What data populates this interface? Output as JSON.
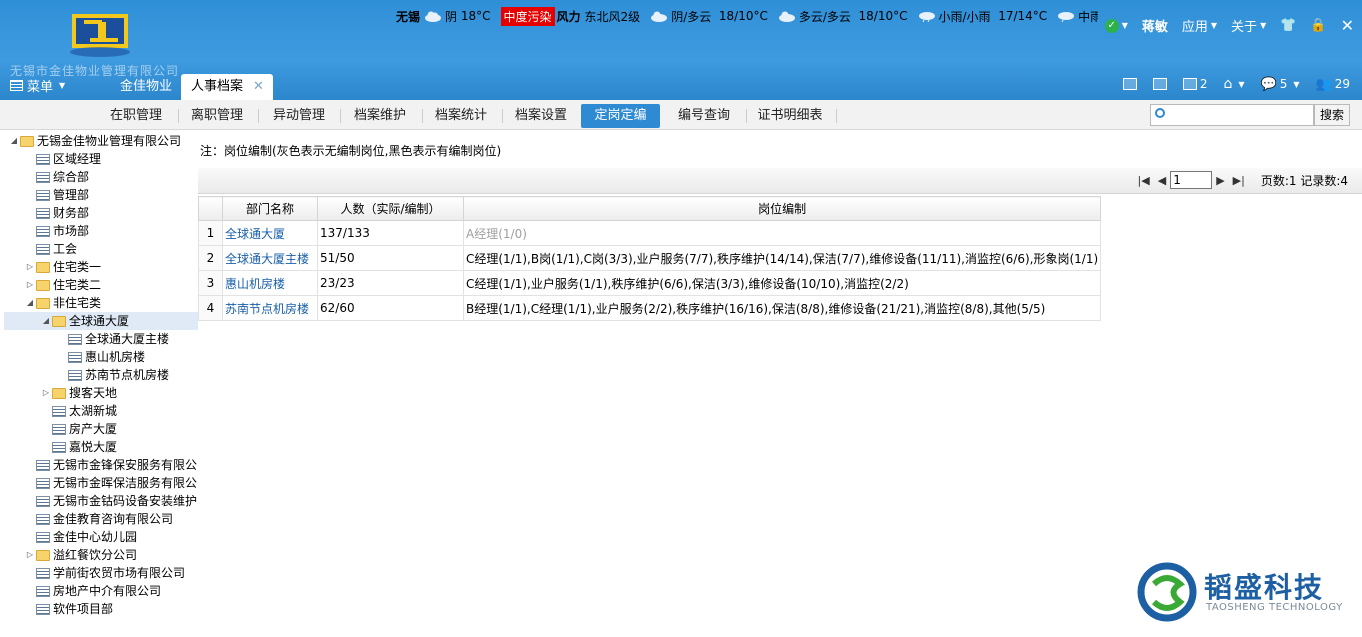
{
  "header": {
    "company_name": "无锡市金佳物业管理有限公司",
    "weather": {
      "city": "无锡",
      "today": {
        "condition": "阴",
        "temp": "18°C"
      },
      "pollution": "中度污染",
      "wind_label": "风力",
      "wind": "东北风2级",
      "forecast": [
        {
          "condition": "阴/多云",
          "temp": "18/10°C"
        },
        {
          "condition": "多云/多云",
          "temp": "18/10°C"
        },
        {
          "condition": "小雨/小雨",
          "temp": "17/14°C"
        },
        {
          "condition": "中雨/阴",
          "temp": ""
        }
      ]
    },
    "user": {
      "name": "蒋敏",
      "status_icon": "check-circle-icon"
    },
    "menus": {
      "apps": "应用",
      "about": "关于"
    },
    "icons": [
      "shirt-icon",
      "lock-icon",
      "close-icon"
    ]
  },
  "tabbar": {
    "menu_label": "菜单",
    "tabs": [
      {
        "label": "金佳物业",
        "active": false
      },
      {
        "label": "人事档案",
        "active": true
      }
    ],
    "toolbar_counts": {
      "docs": "2",
      "messages": "5",
      "users": "29"
    }
  },
  "subnav": {
    "tabs": [
      "在职管理",
      "离职管理",
      "异动管理",
      "档案维护",
      "档案统计",
      "档案设置",
      "定岗定编",
      "编号查询",
      "证书明细表"
    ],
    "active_index": 6,
    "search": {
      "placeholder": "",
      "button": "搜索"
    }
  },
  "tree": {
    "nodes": [
      {
        "label": "无锡金佳物业管理有限公司",
        "level": 0,
        "type": "folder",
        "expanded": true
      },
      {
        "label": "区域经理",
        "level": 1,
        "type": "leaf"
      },
      {
        "label": "综合部",
        "level": 1,
        "type": "leaf"
      },
      {
        "label": "管理部",
        "level": 1,
        "type": "leaf"
      },
      {
        "label": "财务部",
        "level": 1,
        "type": "leaf"
      },
      {
        "label": "市场部",
        "level": 1,
        "type": "leaf"
      },
      {
        "label": "工会",
        "level": 1,
        "type": "leaf"
      },
      {
        "label": "住宅类一",
        "level": 1,
        "type": "folder",
        "expanded": false
      },
      {
        "label": "住宅类二",
        "level": 1,
        "type": "folder",
        "expanded": false
      },
      {
        "label": "非住宅类",
        "level": 1,
        "type": "folder",
        "expanded": true
      },
      {
        "label": "全球通大厦",
        "level": 2,
        "type": "folder",
        "expanded": true,
        "selected": true
      },
      {
        "label": "全球通大厦主楼",
        "level": 3,
        "type": "leaf"
      },
      {
        "label": "惠山机房楼",
        "level": 3,
        "type": "leaf"
      },
      {
        "label": "苏南节点机房楼",
        "level": 3,
        "type": "leaf"
      },
      {
        "label": "搜客天地",
        "level": 2,
        "type": "folder",
        "expanded": false
      },
      {
        "label": "太湖新城",
        "level": 2,
        "type": "leaf"
      },
      {
        "label": "房产大厦",
        "level": 2,
        "type": "leaf"
      },
      {
        "label": "嘉悦大厦",
        "level": 2,
        "type": "leaf"
      },
      {
        "label": "无锡市金锋保安服务有限公司",
        "level": 1,
        "type": "leaf"
      },
      {
        "label": "无锡市金晖保洁服务有限公司",
        "level": 1,
        "type": "leaf"
      },
      {
        "label": "无锡市金钴码设备安装维护",
        "level": 1,
        "type": "leaf"
      },
      {
        "label": "金佳教育咨询有限公司",
        "level": 1,
        "type": "leaf"
      },
      {
        "label": "金佳中心幼儿园",
        "level": 1,
        "type": "leaf"
      },
      {
        "label": "溢红餐饮分公司",
        "level": 1,
        "type": "folder",
        "expanded": false
      },
      {
        "label": "学前街农贸市场有限公司",
        "level": 1,
        "type": "leaf"
      },
      {
        "label": "房地产中介有限公司",
        "level": 1,
        "type": "leaf"
      },
      {
        "label": "软件项目部",
        "level": 1,
        "type": "leaf"
      }
    ]
  },
  "main": {
    "note": "注：岗位编制(灰色表示无编制岗位,黑色表示有编制岗位)",
    "pager": {
      "current_page": "1",
      "info": "页数:1 记录数:4"
    },
    "table": {
      "columns": [
        "",
        "部门名称",
        "人数（实际/编制）",
        "岗位编制"
      ],
      "rows": [
        {
          "index": "1",
          "dept": "全球通大厦",
          "count": "137/133",
          "posts": "A经理(1/0)",
          "gray": true
        },
        {
          "index": "2",
          "dept": "全球通大厦主楼",
          "count": "51/50",
          "posts": "C经理(1/1),B岗(1/1),C岗(3/3),业户服务(7/7),秩序维护(14/14),保洁(7/7),维修设备(11/11),消监控(6/6),形象岗(1/1)",
          "gray": false
        },
        {
          "index": "3",
          "dept": "惠山机房楼",
          "count": "23/23",
          "posts": "C经理(1/1),业户服务(1/1),秩序维护(6/6),保洁(3/3),维修设备(10/10),消监控(2/2)",
          "gray": false
        },
        {
          "index": "4",
          "dept": "苏南节点机房楼",
          "count": "62/60",
          "posts": "B经理(1/1),C经理(1/1),业户服务(2/2),秩序维护(16/16),保洁(8/8),维修设备(21/21),消监控(8/8),其他(5/5)",
          "gray": false
        }
      ]
    }
  },
  "brand": {
    "name": "韬盛科技",
    "sub": "TAOSHENG TECHNOLOGY"
  },
  "colors": {
    "header": "#2f8fd6",
    "active_tab": "#2f8ad4",
    "link": "#1a5fa8",
    "pollution": "#e60000"
  }
}
